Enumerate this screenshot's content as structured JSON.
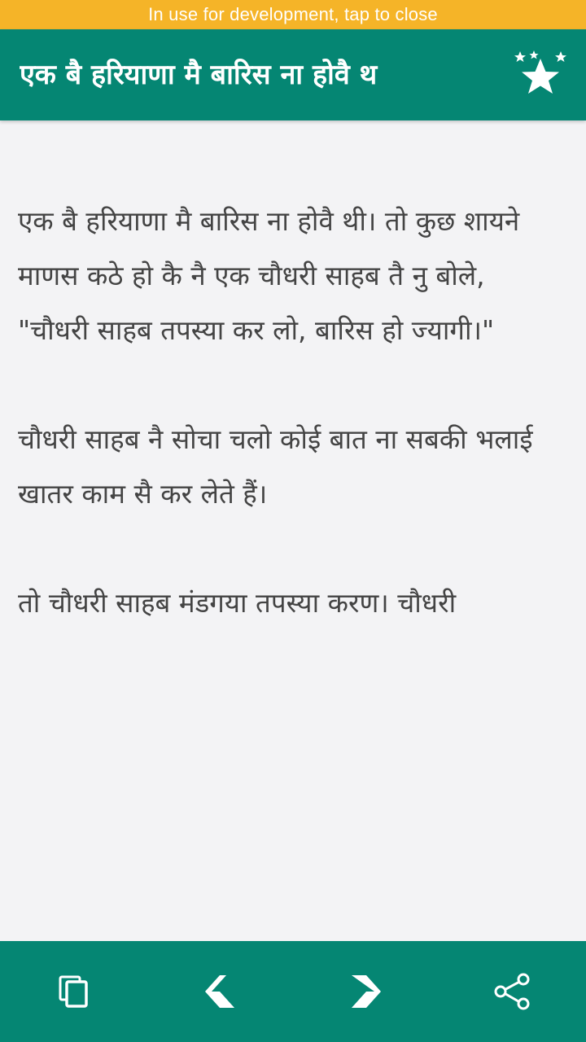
{
  "dev_banner": {
    "text": "In use for development, tap to close"
  },
  "app_bar": {
    "title": "एक बै हरियाणा मै बारिस ना होवै थ",
    "rate_icon": "stars-icon"
  },
  "story": {
    "text": "एक बै हरियाणा मै बारिस ना होवै थी। तो कुछ शायने माणस कठे हो कै नै एक चौधरी साहब तै नु बोले, \"चौधरी साहब तपस्या कर लो, बारिस हो ज्यागी।\"\n\nचौधरी साहब नै सोचा चलो कोई बात ना सबकी भलाई खातर काम सै कर लेते हैं।\n\nतो चौधरी साहब मंडगया तपस्या करण। चौधरी"
  },
  "bottom_bar": {
    "copy_icon": "copy-icon",
    "previous_icon": "previous-icon",
    "next_icon": "next-icon",
    "share_icon": "share-icon"
  },
  "colors": {
    "primary": "#058673",
    "banner": "#f5b428",
    "background": "#f3f3f5",
    "text": "#444444"
  }
}
